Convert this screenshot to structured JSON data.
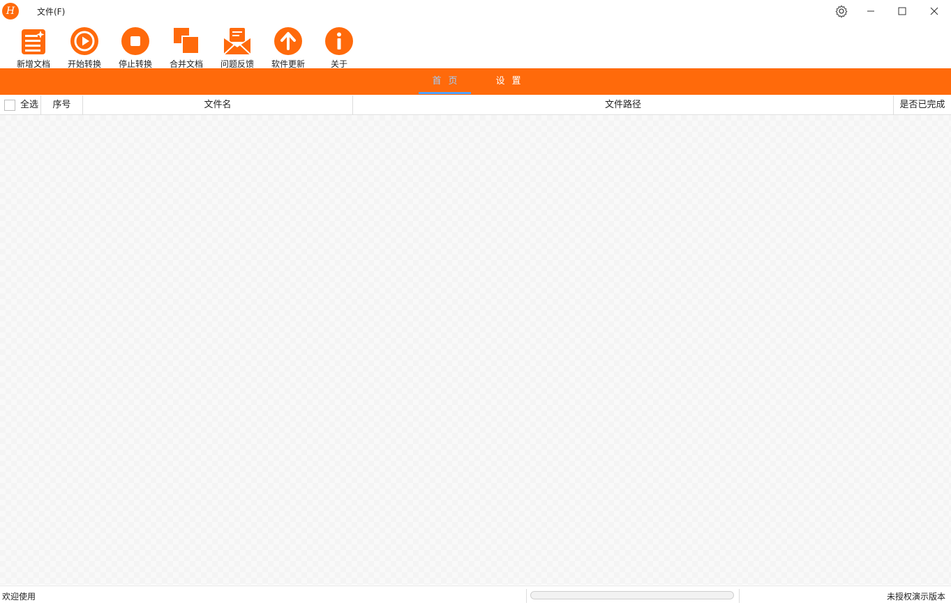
{
  "app": {
    "logo_letter": "H",
    "brand_color": "#ff6a0b"
  },
  "menu": {
    "file": "文件(F)"
  },
  "toolbar": {
    "items": [
      {
        "label": "新增文档",
        "icon": "add-document-icon"
      },
      {
        "label": "开始转换",
        "icon": "play-icon"
      },
      {
        "label": "停止转换",
        "icon": "stop-icon"
      },
      {
        "label": "合并文档",
        "icon": "merge-icon"
      },
      {
        "label": "问题反馈",
        "icon": "mail-icon"
      },
      {
        "label": "软件更新",
        "icon": "update-arrow-icon"
      },
      {
        "label": "关于",
        "icon": "info-icon"
      }
    ]
  },
  "nav": {
    "tabs": [
      {
        "label": "首页",
        "active": true
      },
      {
        "label": "设置",
        "active": false
      }
    ],
    "active_color": "#9fd0ff",
    "underline_color": "#4fa3ff"
  },
  "table": {
    "select_all": "全选",
    "columns": [
      "序号",
      "文件名",
      "文件路径",
      "是否已完成"
    ],
    "rows": []
  },
  "status": {
    "left": "欢迎使用",
    "right": "未授权演示版本",
    "progress": 0
  }
}
